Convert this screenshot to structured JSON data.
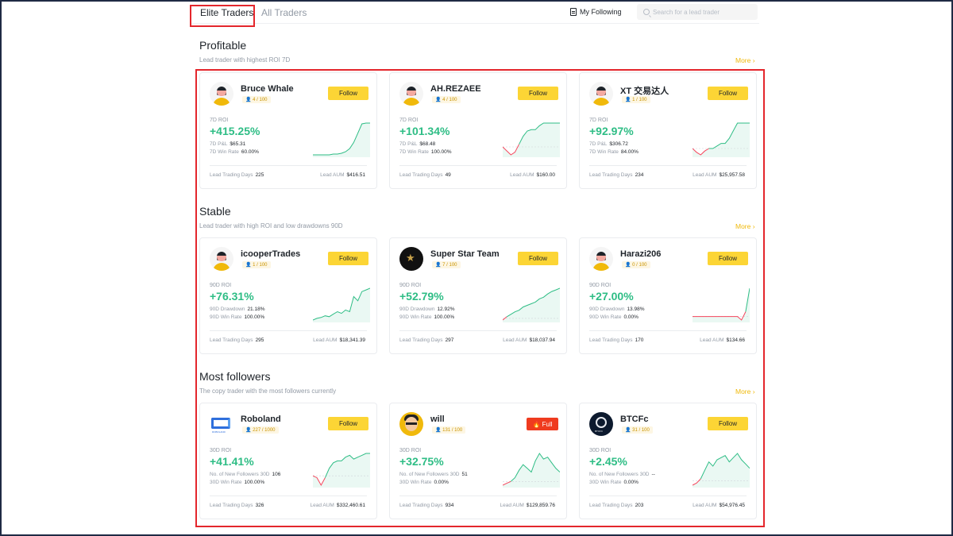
{
  "nav": {
    "tabs": [
      {
        "label": "Elite Traders",
        "active": true
      },
      {
        "label": "All Traders",
        "active": false
      }
    ],
    "my_following": "My Following",
    "search_placeholder": "Search for a lead trader"
  },
  "colors": {
    "accent": "#fcd535",
    "positive": "#2ebd85",
    "negative": "#f6465d",
    "highlight": "#e4262c"
  },
  "sections": [
    {
      "title": "Profitable",
      "subtitle": "Lead trader with highest ROI 7D",
      "more": "More",
      "cards": [
        {
          "name": "Bruce Whale",
          "avatar": "default-avatar",
          "slots": "4 / 100",
          "button": "Follow",
          "roi_label": "7D ROI",
          "roi": "+415.25%",
          "stat1_label": "7D P&L",
          "stat1_value": "$65.31",
          "stat2_label": "7D Win Rate",
          "stat2_value": "60.00%",
          "days_label": "Lead Trading Days",
          "days": "225",
          "aum_label": "Lead AUM",
          "aum": "$416.51",
          "spark": [
            2,
            2,
            2,
            2,
            2,
            3,
            3,
            4,
            6,
            10,
            18,
            30,
            42,
            43,
            43
          ],
          "neg_until": 0
        },
        {
          "name": "AH.REZAEE",
          "avatar": "default-avatar",
          "slots": "4 / 100",
          "button": "Follow",
          "roi_label": "7D ROI",
          "roi": "+101.34%",
          "stat1_label": "7D P&L",
          "stat1_value": "$68.48",
          "stat2_label": "7D Win Rate",
          "stat2_value": "100.00%",
          "days_label": "Lead Trading Days",
          "days": "49",
          "aum_label": "Lead AUM",
          "aum": "$160.00",
          "spark": [
            0,
            -3,
            -6,
            -4,
            2,
            8,
            12,
            13,
            13,
            16,
            18,
            18,
            18,
            18,
            18
          ],
          "neg_until": 4
        },
        {
          "name": "XT 交易达人",
          "avatar": "default-avatar",
          "slots": "1 / 100",
          "button": "Follow",
          "roi_label": "7D ROI",
          "roi": "+92.97%",
          "stat1_label": "7D P&L",
          "stat1_value": "$306.72",
          "stat2_label": "7D Win Rate",
          "stat2_value": "84.00%",
          "days_label": "Lead Trading Days",
          "days": "234",
          "aum_label": "Lead AUM",
          "aum": "$25,957.58",
          "spark": [
            0,
            -3,
            -5,
            -2,
            0,
            0,
            2,
            4,
            4,
            8,
            14,
            20,
            20,
            20,
            20
          ],
          "neg_until": 4
        }
      ]
    },
    {
      "title": "Stable",
      "subtitle": "Lead trader with high ROI and low drawdowns 90D",
      "more": "More",
      "cards": [
        {
          "name": "icooperTrades",
          "avatar": "default-avatar",
          "slots": "1 / 100",
          "button": "Follow",
          "roi_label": "90D ROI",
          "roi": "+76.31%",
          "stat1_label": "90D Drawdown",
          "stat1_value": "21.18%",
          "stat2_label": "90D Win Rate",
          "stat2_value": "100.00%",
          "days_label": "Lead Trading Days",
          "days": "295",
          "aum_label": "Lead AUM",
          "aum": "$18,341.39",
          "spark": [
            2,
            4,
            5,
            7,
            6,
            9,
            12,
            10,
            14,
            12,
            30,
            25,
            36,
            38,
            40
          ],
          "neg_until": 0
        },
        {
          "name": "Super Star Team",
          "avatar": "star-avatar",
          "slots": "7 / 100",
          "button": "Follow",
          "roi_label": "90D ROI",
          "roi": "+52.79%",
          "stat1_label": "90D Drawdown",
          "stat1_value": "12.92%",
          "stat2_label": "90D Win Rate",
          "stat2_value": "100.00%",
          "days_label": "Lead Trading Days",
          "days": "297",
          "aum_label": "Lead AUM",
          "aum": "$18,037.94",
          "spark": [
            -2,
            2,
            5,
            8,
            10,
            14,
            16,
            18,
            20,
            24,
            26,
            30,
            33,
            35,
            37
          ],
          "neg_until": 1
        },
        {
          "name": "Harazi206",
          "avatar": "default-avatar",
          "slots": "0 / 100",
          "button": "Follow",
          "roi_label": "90D ROI",
          "roi": "+27.00%",
          "stat1_label": "90D Drawdown",
          "stat1_value": "13.98%",
          "stat2_label": "90D Win Rate",
          "stat2_value": "0.00%",
          "days_label": "Lead Trading Days",
          "days": "170",
          "aum_label": "Lead AUM",
          "aum": "$134.66",
          "spark": [
            0,
            0,
            0,
            0,
            0,
            0,
            0,
            0,
            0,
            0,
            0,
            0,
            -3,
            4,
            24
          ],
          "neg_until": 13
        },
        {
          "_": ""
        }
      ]
    },
    {
      "title": "Most followers",
      "subtitle": "The copy trader with the most followers currently",
      "more": "More",
      "cards": [
        {
          "name": "Roboland",
          "avatar": "roboland-logo",
          "slots": "227 / 1000",
          "button": "Follow",
          "roi_label": "30D ROI",
          "roi": "+41.41%",
          "stat1_label": "No. of New Followers 30D",
          "stat1_value": "106",
          "stat2_label": "30D Win Rate",
          "stat2_value": "100.00%",
          "days_label": "Lead Trading Days",
          "days": "326",
          "aum_label": "Lead AUM",
          "aum": "$332,460.61",
          "spark": [
            0,
            -2,
            -10,
            -2,
            8,
            14,
            16,
            16,
            20,
            22,
            18,
            20,
            22,
            24,
            24
          ],
          "neg_until": 3
        },
        {
          "name": "will",
          "avatar": "cartoon-avatar",
          "slots": "131 / 100",
          "button": "Full",
          "roi_label": "30D ROI",
          "roi": "+32.75%",
          "stat1_label": "No. of New Followers 30D",
          "stat1_value": "51",
          "stat2_label": "30D Win Rate",
          "stat2_value": "0.00%",
          "days_label": "Lead Trading Days",
          "days": "934",
          "aum_label": "Lead AUM",
          "aum": "$129,859.76",
          "spark": [
            -4,
            -2,
            0,
            4,
            12,
            18,
            14,
            10,
            22,
            30,
            24,
            26,
            20,
            14,
            10
          ],
          "neg_until": 2
        },
        {
          "name": "BTCFc",
          "avatar": "btcfc-logo",
          "slots": "31 / 100",
          "button": "Follow",
          "roi_label": "30D ROI",
          "roi": "+2.45%",
          "stat1_label": "No. of New Followers 30D",
          "stat1_value": "--",
          "stat2_label": "30D Win Rate",
          "stat2_value": "0.00%",
          "days_label": "Lead Trading Days",
          "days": "203",
          "aum_label": "Lead AUM",
          "aum": "$54,976.45",
          "spark": [
            -4,
            -2,
            2,
            10,
            18,
            14,
            20,
            22,
            24,
            18,
            22,
            26,
            20,
            16,
            12
          ],
          "neg_until": 2
        }
      ]
    }
  ]
}
